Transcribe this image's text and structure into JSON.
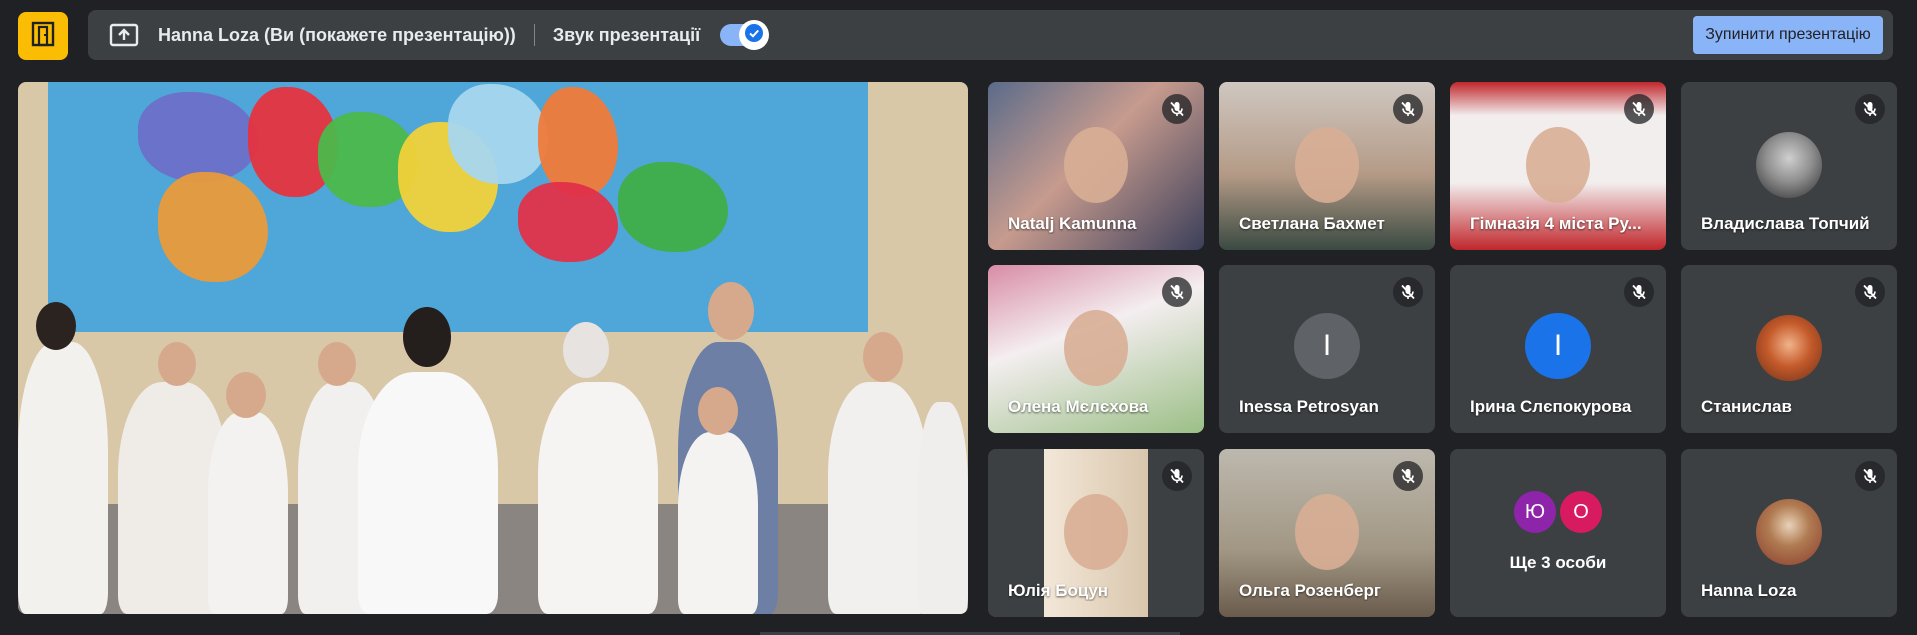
{
  "topbar": {
    "logo_icon": "present-to-all-door-icon",
    "presenter_label": "Hanna Loza (Ви (покажете презентацію))",
    "sound_label": "Звук презентації",
    "sound_enabled": true,
    "stop_button_label": "Зупинити презентацію",
    "accent_color": "#8ab4f8",
    "logo_color": "#fbbc04"
  },
  "main_stage": {
    "content": "shared-video"
  },
  "participants": [
    {
      "name": "Natalj Kamunna",
      "muted": true,
      "type": "video"
    },
    {
      "name": "Светлана Бахмет",
      "muted": true,
      "type": "video"
    },
    {
      "name": "Гімназія 4 міста Ру...",
      "muted": true,
      "type": "video"
    },
    {
      "name": "Владислава Топчий",
      "muted": true,
      "type": "photo"
    },
    {
      "name": "Олена Мєлєхова",
      "muted": true,
      "type": "video"
    },
    {
      "name": "Inessa Petrosyan",
      "muted": true,
      "type": "initial",
      "initial": "I",
      "color": "#5f6368"
    },
    {
      "name": "Ірина Слєпокурова",
      "muted": true,
      "type": "initial",
      "initial": "І",
      "color": "#1a73e8"
    },
    {
      "name": "Станислав",
      "muted": true,
      "type": "photo"
    },
    {
      "name": "Юлія Боцун",
      "muted": true,
      "type": "video"
    },
    {
      "name": "Ольга Розенберг",
      "muted": true,
      "type": "video"
    },
    {
      "name": "Hanna Loza",
      "muted": true,
      "type": "photo"
    }
  ],
  "more_people": {
    "label": "Ще 3 особи",
    "avatars": [
      {
        "initial": "Ю",
        "color": "#8e24aa"
      },
      {
        "initial": "О",
        "color": "#d81b60"
      }
    ]
  }
}
